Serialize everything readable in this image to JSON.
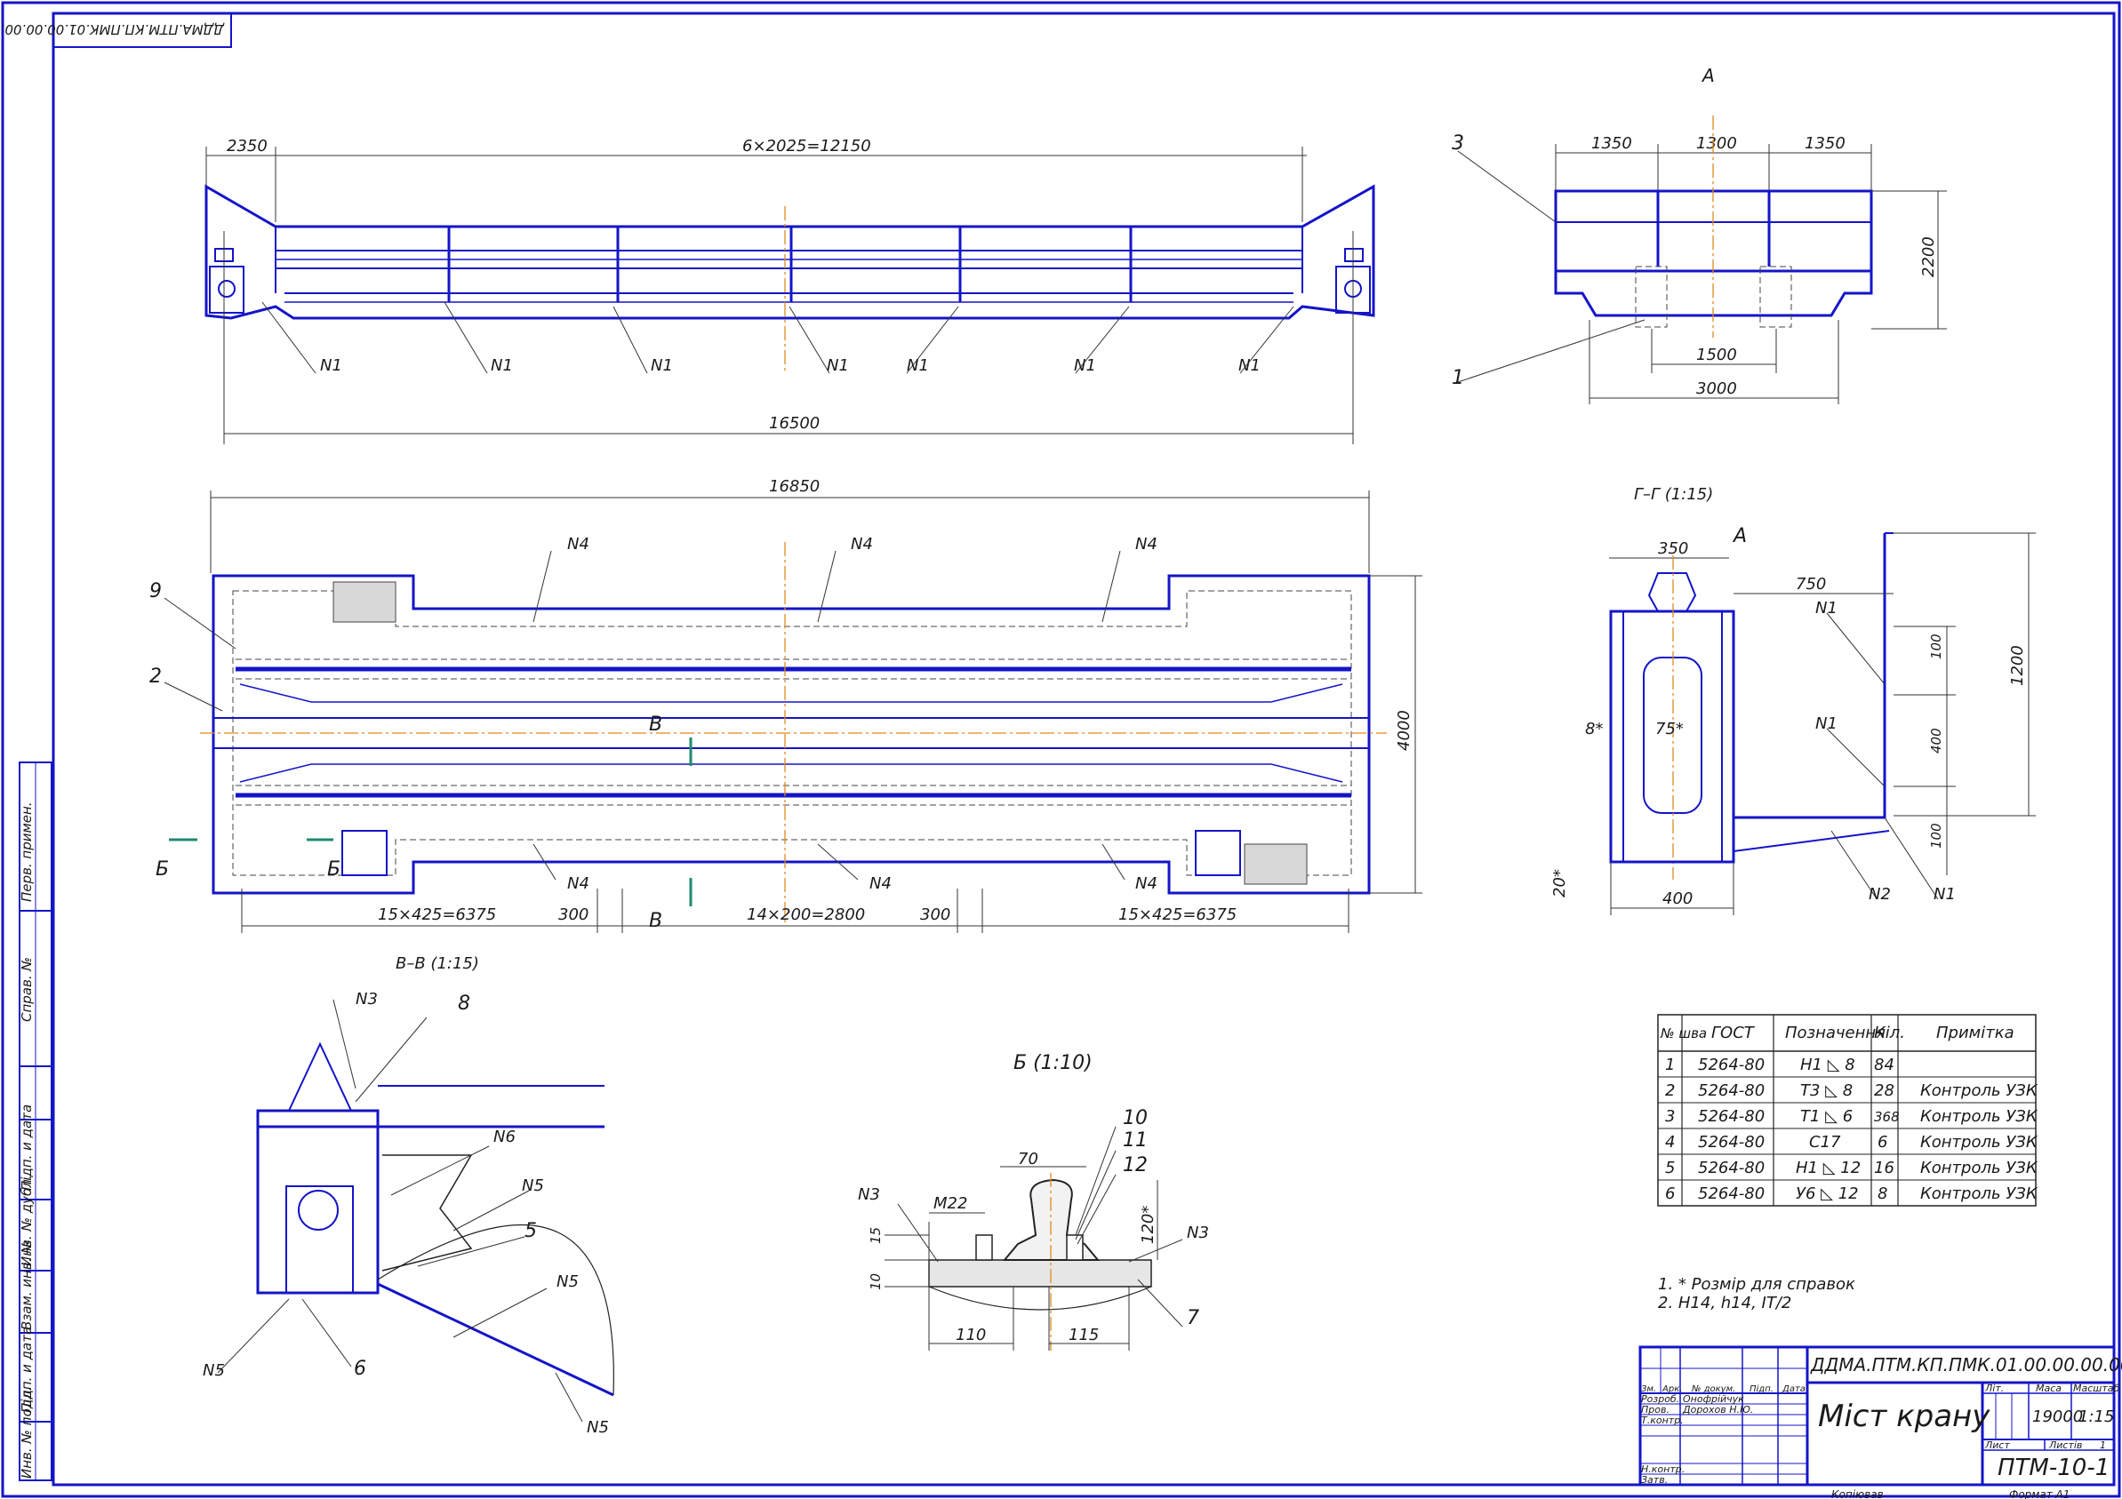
{
  "colors": {
    "frame": "#1414c8",
    "lines": "#222222",
    "axis": "#e08a1e",
    "section_mark": "#1e8a6e",
    "rail": "#1414c8"
  },
  "corner_code": "ДДМА.ПТМ.КП.ПМК.01.00.00.00.00.ЗК",
  "top_view": {
    "dims": {
      "end_bay": "2350",
      "bays": "6×2025=12150",
      "wheelbase": "16500"
    },
    "weld_marks": [
      "N1",
      "N1",
      "N1",
      "N1",
      "N1",
      "N1",
      "N1"
    ]
  },
  "view_a": {
    "title": "А",
    "dims": {
      "d1": "1350",
      "d2": "1300",
      "d3": "1350",
      "height": "2200",
      "inner": "1500",
      "span": "3000"
    },
    "callouts": [
      "3",
      "1"
    ]
  },
  "plan_view": {
    "overall": "16850",
    "width": "4000",
    "weld_marks_top": [
      "N4",
      "N4",
      "N4"
    ],
    "weld_marks_bottom": [
      "N4",
      "N4",
      "N4"
    ],
    "callouts": [
      "9",
      "2"
    ],
    "section_b": "Б",
    "section_v": "В",
    "bottom_dims": {
      "left": "15×425=6375",
      "gap_left": "300",
      "middle": "14×200=2800",
      "gap_right": "300",
      "right": "15×425=6375"
    }
  },
  "section_g": {
    "title": "Г–Г (1:15)",
    "view_ref": "А",
    "dims": {
      "top": "350",
      "reach": "750",
      "height": "1200",
      "d100a": "100",
      "d400": "400",
      "d100b": "100",
      "bottom": "400",
      "left_wall": "8*",
      "web": "75*",
      "angle": "20*"
    },
    "weld_marks": [
      "N1",
      "N1",
      "N2",
      "N1"
    ]
  },
  "section_v": {
    "title": "В–В (1:15)",
    "callouts": [
      "N3",
      "8",
      "N6",
      "N5",
      "5",
      "N5",
      "N5",
      "6",
      "N5"
    ]
  },
  "detail_b": {
    "title": "Б (1:10)",
    "callouts": [
      "10",
      "11",
      "12",
      "7"
    ],
    "labels": {
      "n3_left": "N3",
      "n3_right": "N3",
      "bolt": "M22",
      "w70": "70",
      "h120": "120*",
      "h15": "15",
      "h10": "10",
      "w110": "110",
      "w115": "115"
    }
  },
  "weld_table": {
    "headers": [
      "№ шва",
      "ГОСТ",
      "Позначення",
      "Кіл.",
      "Примітка"
    ],
    "rows": [
      [
        "1",
        "5264-80",
        "Н1 ◺ 8",
        "84",
        ""
      ],
      [
        "2",
        "5264-80",
        "Т3 ◺ 8",
        "28",
        "Контроль УЗК"
      ],
      [
        "3",
        "5264-80",
        "Т1 ◺ 6",
        "368",
        "Контроль УЗК"
      ],
      [
        "4",
        "5264-80",
        "С17",
        "6",
        "Контроль УЗК"
      ],
      [
        "5",
        "5264-80",
        "Н1 ◺ 12",
        "16",
        "Контроль УЗК"
      ],
      [
        "6",
        "5264-80",
        "У6 ◺ 12",
        "8",
        "Контроль УЗК"
      ]
    ]
  },
  "notes": [
    "1. * Розмір для справок",
    "2. Н14, h14, IT/2"
  ],
  "title_block": {
    "code": "ДДМА.ПТМ.КП.ПМК.01.00.00.00.00.ЗК",
    "name": "Міст крану",
    "designation": "ПТМ-10-1",
    "col_lit": "Літ.",
    "col_mass": "Маса",
    "col_scale": "Масштаб",
    "mass": "19000",
    "scale": "1:15",
    "sheet_label": "Лист",
    "sheets_label": "Листів",
    "sheets": "1",
    "rows_left": [
      "Зм.",
      "Арк.",
      "№ докум.",
      "Підп.",
      "Дата"
    ],
    "role_dev": "Розроб.",
    "dev_name": "Онофрійчук",
    "role_check": "Пров.",
    "check_name": "Дорохов Н.Ю.",
    "role_tech": "Т.контр.",
    "role_norm": "Н.контр.",
    "role_appr": "Затв.",
    "copied": "Копіював",
    "format": "Формат   А1"
  },
  "side_stamps": [
    "Перв. примен.",
    "Справ. №",
    "Підп. и дата",
    "Инв. № дубл.",
    "Взам. инв. №",
    "Підп. и дата",
    "Инв. № подл."
  ]
}
